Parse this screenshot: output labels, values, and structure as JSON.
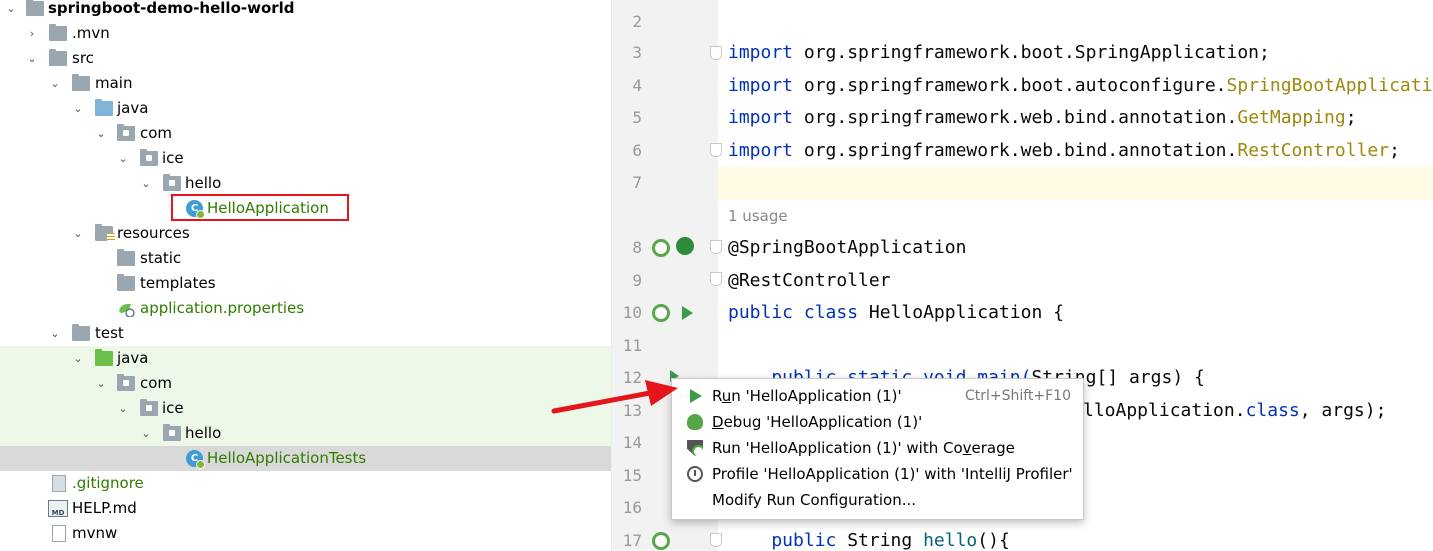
{
  "project_tree": {
    "items": [
      {
        "label": "springboot-demo-hello-world"
      },
      {
        "label": ".mvn"
      },
      {
        "label": "src"
      },
      {
        "label": "main"
      },
      {
        "label": "java"
      },
      {
        "label": "com"
      },
      {
        "label": "ice"
      },
      {
        "label": "hello"
      },
      {
        "label": "HelloApplication"
      },
      {
        "label": "resources"
      },
      {
        "label": "static"
      },
      {
        "label": "templates"
      },
      {
        "label": "application.properties"
      },
      {
        "label": "test"
      },
      {
        "label": "java"
      },
      {
        "label": "com"
      },
      {
        "label": "ice"
      },
      {
        "label": "hello"
      },
      {
        "label": "HelloApplicationTests"
      },
      {
        "label": ".gitignore"
      },
      {
        "label": "HELP.md"
      },
      {
        "label": "mvnw"
      }
    ],
    "md_icon_text": "MD",
    "class_icon_text": "C"
  },
  "editor": {
    "line_numbers": [
      "2",
      "3",
      "4",
      "5",
      "6",
      "7",
      "8",
      "9",
      "10",
      "11",
      "12",
      "13",
      "14",
      "15",
      "16",
      "17"
    ],
    "usage_hint": "1 usage",
    "code": {
      "l3_kw": "import",
      "l3_rest": " org.springframework.boot.SpringApplication;",
      "l4_kw": "import",
      "l4_rest": " org.springframework.boot.autoconfigure.",
      "l4_ann": "SpringBootApplicati",
      "l5_kw": "import",
      "l5_rest": " org.springframework.web.bind.annotation.",
      "l5_ann": "GetMapping",
      "l5_end": ";",
      "l6_kw": "import",
      "l6_rest": " org.springframework.web.bind.annotation.",
      "l6_ann": "RestController",
      "l6_end": ";",
      "l8": "@SpringBootApplication",
      "l9": "@RestController",
      "l10_kw": "public class",
      "l10_rest": " HelloApplication {",
      "l12_partial": "    public static void main(",
      "l12_tail": "String[] args) {",
      "l13_tail": "lloApplication.",
      "l13_kw": "class",
      "l13_end": ", args);",
      "l17_kw": "    public",
      "l17_rest": " String ",
      "l17_mth": "hello",
      "l17_end": "(){"
    }
  },
  "popup_menu": {
    "items": [
      {
        "prefix": "R",
        "mnemonic": "u",
        "suffix": "n 'HelloApplication (1)'",
        "shortcut": "Ctrl+Shift+F10",
        "icon": "run-icon"
      },
      {
        "prefix": "",
        "mnemonic": "D",
        "suffix": "ebug 'HelloApplication (1)'",
        "icon": "debug-icon"
      },
      {
        "prefix": "Run 'HelloApplication (1)' with Co",
        "mnemonic": "v",
        "suffix": "erage",
        "icon": "coverage-icon"
      },
      {
        "prefix": "Profile 'HelloApplication (1)' with 'IntelliJ Profiler'",
        "mnemonic": "",
        "suffix": "",
        "icon": "profiler-icon"
      },
      {
        "prefix": "Modify Run Configuration...",
        "mnemonic": "",
        "suffix": "",
        "icon": ""
      }
    ]
  },
  "colors": {
    "keyword": "#0033b3",
    "annotation": "#9e880d",
    "method": "#00627a",
    "tree_green_text": "#2f7d00",
    "annotation_red": "#e4161b",
    "run_green": "#3e9b4c"
  }
}
